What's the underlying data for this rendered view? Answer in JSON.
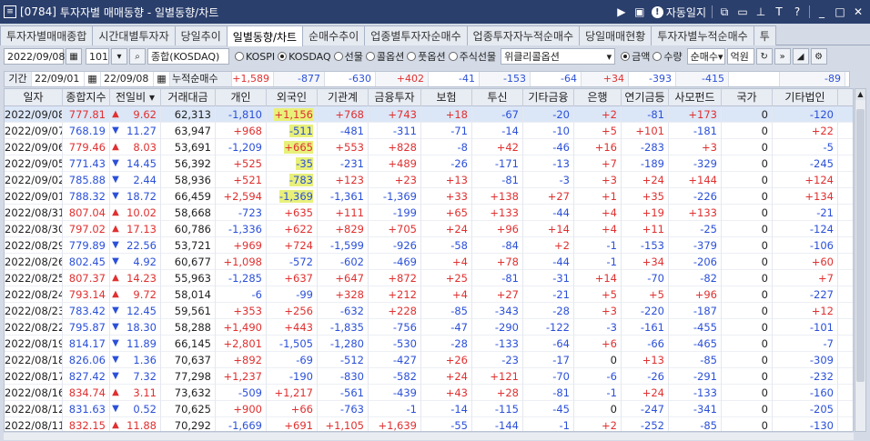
{
  "window": {
    "code": "[0784]",
    "title": "투자자별 매매동향 - 일별동향/차트",
    "autolog_label": "자동일지",
    "help_label": "T",
    "question_label": "?"
  },
  "tabs": [
    {
      "label": "투자자별매매종합",
      "active": false
    },
    {
      "label": "시간대별투자자",
      "active": false
    },
    {
      "label": "당일추이",
      "active": false
    },
    {
      "label": "일별동향/차트",
      "active": true
    },
    {
      "label": "순매수추이",
      "active": false
    },
    {
      "label": "업종별투자자순매수",
      "active": false
    },
    {
      "label": "업종투자자누적순매수",
      "active": false
    },
    {
      "label": "당일매매현황",
      "active": false
    },
    {
      "label": "투자자별누적순매수",
      "active": false
    },
    {
      "label": "투",
      "active": false
    }
  ],
  "toolbar": {
    "date": "2022/09/08",
    "code": "101",
    "market": "종합(KOSDAQ)",
    "radios": [
      {
        "label": "KOSPI",
        "on": false
      },
      {
        "label": "KOSDAQ",
        "on": true
      },
      {
        "label": "선물",
        "on": false
      },
      {
        "label": "콜옵션",
        "on": false
      },
      {
        "label": "풋옵션",
        "on": false
      },
      {
        "label": "주식선물",
        "on": false
      }
    ],
    "weekly_select": "위클리콜옵션",
    "unit_radios": [
      {
        "label": "금액",
        "on": true
      },
      {
        "label": "수량",
        "on": false
      }
    ],
    "type_select": "순매수",
    "unit_label": "억원"
  },
  "summary": {
    "period_label": "기간",
    "from": "22/09/01",
    "to": "22/09/08",
    "accum_label": "누적순매수",
    "values": [
      "+1,589",
      "-877",
      "-630",
      "+402",
      "-41",
      "-153",
      "-64",
      "+34",
      "-393",
      "-415",
      "",
      "-89"
    ]
  },
  "columns": [
    "일자",
    "종합지수",
    "전일비",
    "거래대금",
    "개인",
    "외국인",
    "기관계",
    "금융투자",
    "보험",
    "투신",
    "기타금융",
    "은행",
    "연기금등",
    "사모펀드",
    "국가",
    "기타법인"
  ],
  "rows": [
    {
      "date": "2022/09/08",
      "idx": "777.81",
      "dir": "up",
      "chg": "9.62",
      "amt": "62,313",
      "v": [
        "-1,810",
        "+1,156",
        "+768",
        "+743",
        "+18",
        "-67",
        "-20",
        "+2",
        "-81",
        "+173",
        "0",
        "-120"
      ],
      "hl": true
    },
    {
      "date": "2022/09/07",
      "idx": "768.19",
      "dir": "down",
      "chg": "11.27",
      "amt": "63,947",
      "v": [
        "+968",
        "-511",
        "-481",
        "-311",
        "-71",
        "-14",
        "-10",
        "+5",
        "+101",
        "-181",
        "0",
        "+22"
      ],
      "hl": true
    },
    {
      "date": "2022/09/06",
      "idx": "779.46",
      "dir": "up",
      "chg": "8.03",
      "amt": "53,691",
      "v": [
        "-1,209",
        "+665",
        "+553",
        "+828",
        "-8",
        "+42",
        "-46",
        "+16",
        "-283",
        "+3",
        "0",
        "-5"
      ],
      "hl": true
    },
    {
      "date": "2022/09/05",
      "idx": "771.43",
      "dir": "down",
      "chg": "14.45",
      "amt": "56,392",
      "v": [
        "+525",
        "-35",
        "-231",
        "+489",
        "-26",
        "-171",
        "-13",
        "+7",
        "-189",
        "-329",
        "0",
        "-245"
      ],
      "hl": true
    },
    {
      "date": "2022/09/02",
      "idx": "785.88",
      "dir": "down",
      "chg": "2.44",
      "amt": "58,936",
      "v": [
        "+521",
        "-783",
        "+123",
        "+23",
        "+13",
        "-81",
        "-3",
        "+3",
        "+24",
        "+144",
        "0",
        "+124"
      ],
      "hl": true
    },
    {
      "date": "2022/09/01",
      "idx": "788.32",
      "dir": "down",
      "chg": "18.72",
      "amt": "66,459",
      "v": [
        "+2,594",
        "-1,369",
        "-1,361",
        "-1,369",
        "+33",
        "+138",
        "+27",
        "+1",
        "+35",
        "-226",
        "0",
        "+134"
      ],
      "hl": true
    },
    {
      "date": "2022/08/31",
      "idx": "807.04",
      "dir": "up",
      "chg": "10.02",
      "amt": "58,668",
      "v": [
        "-723",
        "+635",
        "+111",
        "-199",
        "+65",
        "+133",
        "-44",
        "+4",
        "+19",
        "+133",
        "0",
        "-21"
      ],
      "hl": false
    },
    {
      "date": "2022/08/30",
      "idx": "797.02",
      "dir": "up",
      "chg": "17.13",
      "amt": "60,786",
      "v": [
        "-1,336",
        "+622",
        "+829",
        "+705",
        "+24",
        "+96",
        "+14",
        "+4",
        "+11",
        "-25",
        "0",
        "-124"
      ],
      "hl": false
    },
    {
      "date": "2022/08/29",
      "idx": "779.89",
      "dir": "down",
      "chg": "22.56",
      "amt": "53,721",
      "v": [
        "+969",
        "+724",
        "-1,599",
        "-926",
        "-58",
        "-84",
        "+2",
        "-1",
        "-153",
        "-379",
        "0",
        "-106"
      ],
      "hl": false
    },
    {
      "date": "2022/08/26",
      "idx": "802.45",
      "dir": "down",
      "chg": "4.92",
      "amt": "60,677",
      "v": [
        "+1,098",
        "-572",
        "-602",
        "-469",
        "+4",
        "+78",
        "-44",
        "-1",
        "+34",
        "-206",
        "0",
        "+60"
      ],
      "hl": false
    },
    {
      "date": "2022/08/25",
      "idx": "807.37",
      "dir": "up",
      "chg": "14.23",
      "amt": "55,963",
      "v": [
        "-1,285",
        "+637",
        "+647",
        "+872",
        "+25",
        "-81",
        "-31",
        "+14",
        "-70",
        "-82",
        "0",
        "+7"
      ],
      "hl": false
    },
    {
      "date": "2022/08/24",
      "idx": "793.14",
      "dir": "up",
      "chg": "9.72",
      "amt": "58,014",
      "v": [
        "-6",
        "-99",
        "+328",
        "+212",
        "+4",
        "+27",
        "-21",
        "+5",
        "+5",
        "+96",
        "0",
        "-227"
      ],
      "hl": false
    },
    {
      "date": "2022/08/23",
      "idx": "783.42",
      "dir": "down",
      "chg": "12.45",
      "amt": "59,561",
      "v": [
        "+353",
        "+256",
        "-632",
        "+228",
        "-85",
        "-343",
        "-28",
        "+3",
        "-220",
        "-187",
        "0",
        "+12"
      ],
      "hl": false
    },
    {
      "date": "2022/08/22",
      "idx": "795.87",
      "dir": "down",
      "chg": "18.30",
      "amt": "58,288",
      "v": [
        "+1,490",
        "+443",
        "-1,835",
        "-756",
        "-47",
        "-290",
        "-122",
        "-3",
        "-161",
        "-455",
        "0",
        "-101"
      ],
      "hl": false
    },
    {
      "date": "2022/08/19",
      "idx": "814.17",
      "dir": "down",
      "chg": "11.89",
      "amt": "66,145",
      "v": [
        "+2,801",
        "-1,505",
        "-1,280",
        "-530",
        "-28",
        "-133",
        "-64",
        "+6",
        "-66",
        "-465",
        "0",
        "-7"
      ],
      "hl": false
    },
    {
      "date": "2022/08/18",
      "idx": "826.06",
      "dir": "down",
      "chg": "1.36",
      "amt": "70,637",
      "v": [
        "+892",
        "-69",
        "-512",
        "-427",
        "+26",
        "-23",
        "-17",
        "0",
        "+13",
        "-85",
        "0",
        "-309"
      ],
      "hl": false
    },
    {
      "date": "2022/08/17",
      "idx": "827.42",
      "dir": "down",
      "chg": "7.32",
      "amt": "77,298",
      "v": [
        "+1,237",
        "-190",
        "-830",
        "-582",
        "+24",
        "+121",
        "-70",
        "-6",
        "-26",
        "-291",
        "0",
        "-232"
      ],
      "hl": false
    },
    {
      "date": "2022/08/16",
      "idx": "834.74",
      "dir": "up",
      "chg": "3.11",
      "amt": "73,632",
      "v": [
        "-509",
        "+1,217",
        "-561",
        "-439",
        "+43",
        "+28",
        "-81",
        "-1",
        "+24",
        "-133",
        "0",
        "-160"
      ],
      "hl": false
    },
    {
      "date": "2022/08/12",
      "idx": "831.63",
      "dir": "down",
      "chg": "0.52",
      "amt": "70,625",
      "v": [
        "+900",
        "+66",
        "-763",
        "-1",
        "-14",
        "-115",
        "-45",
        "0",
        "-247",
        "-341",
        "0",
        "-205"
      ],
      "hl": false
    },
    {
      "date": "2022/08/11",
      "idx": "832.15",
      "dir": "up",
      "chg": "11.88",
      "amt": "70,292",
      "v": [
        "-1,669",
        "+691",
        "+1,105",
        "+1,639",
        "-55",
        "-144",
        "-1",
        "+2",
        "-252",
        "-85",
        "0",
        "-130"
      ],
      "hl": false
    }
  ],
  "colors": {
    "up": "#e03030",
    "down": "#2b50d8",
    "highlight": "#e8f07a",
    "selected_row": "#dbe6f7",
    "titlebar": "#2b3f6c"
  }
}
